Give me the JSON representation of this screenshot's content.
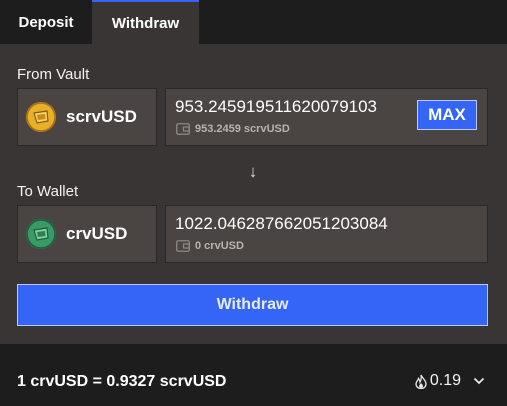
{
  "tabs": [
    {
      "label": "Deposit",
      "active": false
    },
    {
      "label": "Withdraw",
      "active": true
    }
  ],
  "from": {
    "label": "From Vault",
    "token": "scrvUSD",
    "token_icon": "scrvusd-coin-icon",
    "amount": "953.245919511620079103",
    "balance": "953.2459 scrvUSD",
    "max_label": "MAX"
  },
  "arrow": "↓",
  "to": {
    "label": "To Wallet",
    "token": "crvUSD",
    "token_icon": "crvusd-coin-icon",
    "amount": "1022.046287662051203084",
    "balance": "0 crvUSD"
  },
  "action": {
    "label": "Withdraw"
  },
  "footer": {
    "rate": "1 crvUSD = 0.9327 scrvUSD",
    "apy": "0.19"
  },
  "colors": {
    "accent": "#3465f6",
    "panel": "#393534",
    "background": "#1e1d1d"
  }
}
